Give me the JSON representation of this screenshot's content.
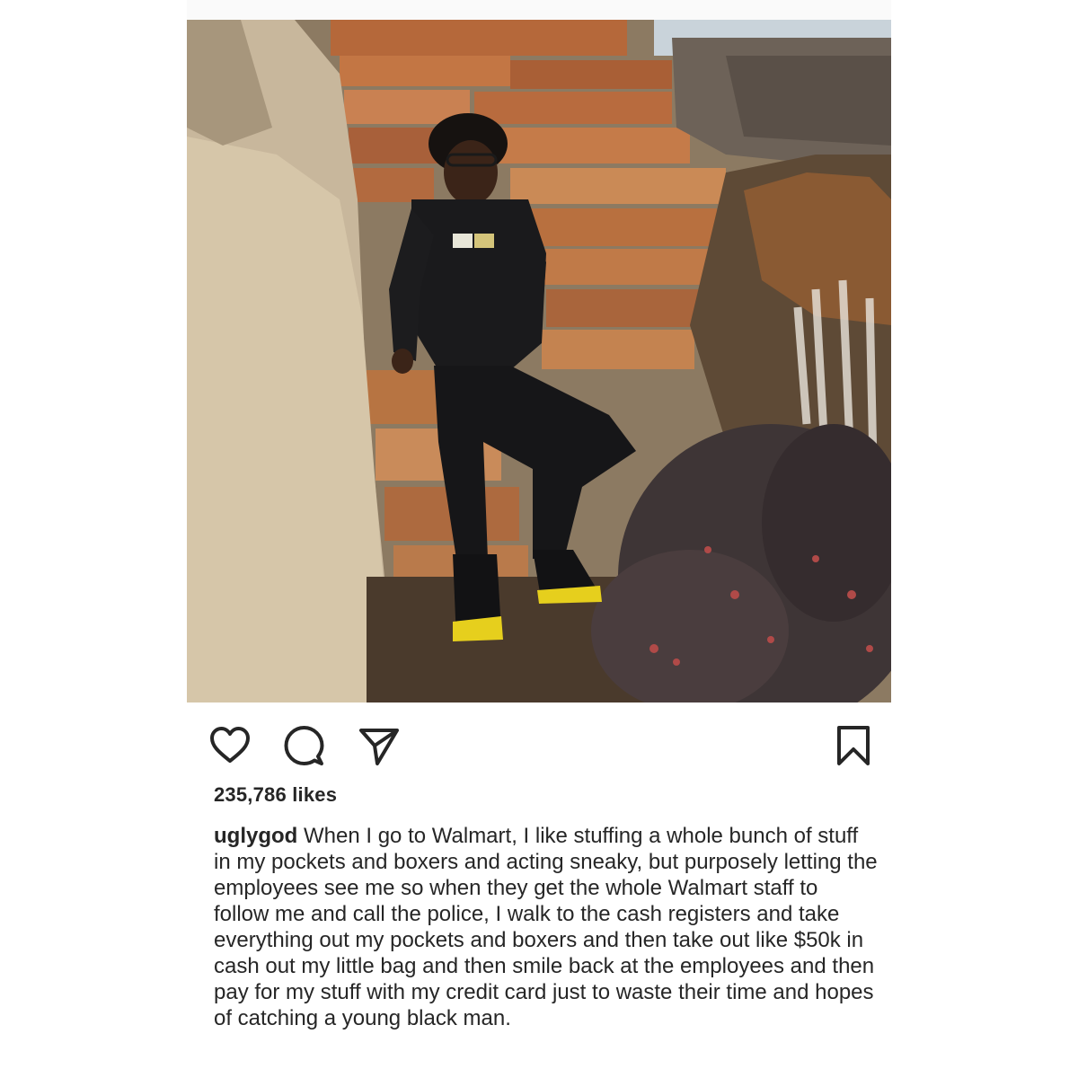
{
  "post": {
    "photo_alt": "",
    "likes": "235,786 likes",
    "username": "uglygod",
    "caption": "When I go to Walmart, I like stuffing a whole bunch of stuff in my pockets and boxers and acting sneaky, but purposely letting the employees see me so when they get the whole Walmart staff to follow me and call the police, I walk to the cash registers and take everything out my pockets and boxers and then take out like $50k in cash out my little bag and then smile back at the employees and then pay for my stuff with my credit card just to waste their time and hopes of catching a young black man."
  },
  "icons": {
    "like": "heart-icon",
    "comment": "comment-icon",
    "share": "paper-plane-icon",
    "save": "bookmark-icon"
  },
  "colors": {
    "text": "#262626",
    "icon": "#262626"
  }
}
